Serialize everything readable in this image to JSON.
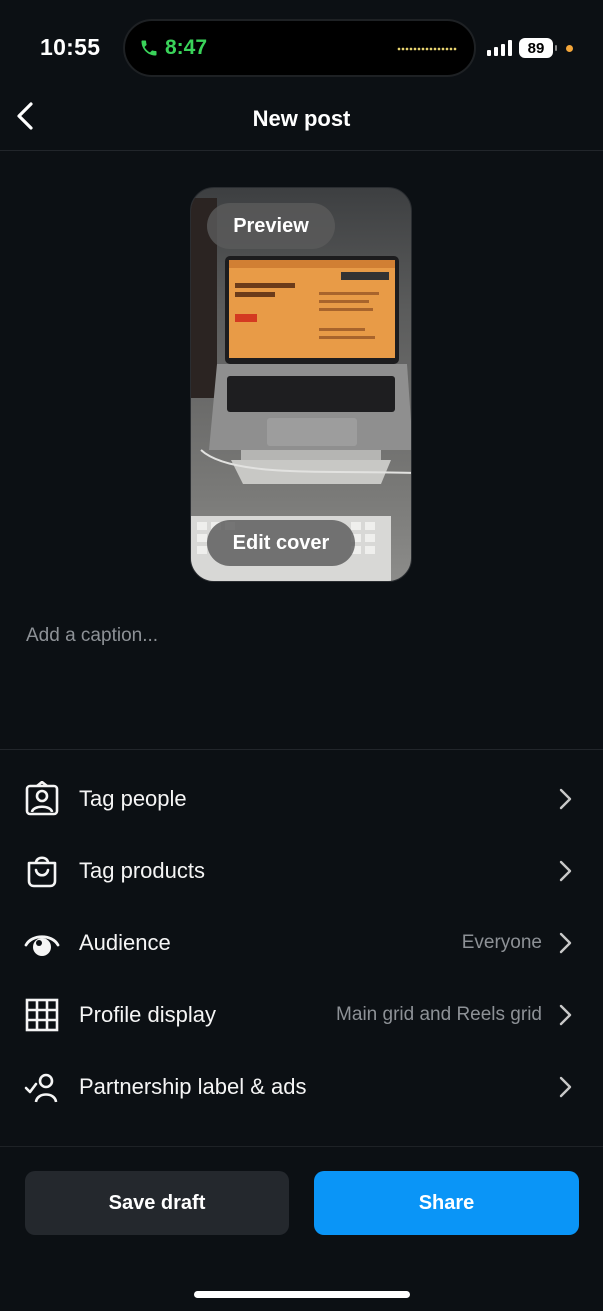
{
  "status_bar": {
    "time": "10:55",
    "call_time": "8:47",
    "battery": "89",
    "call_color": "#3ad35a",
    "privacy_dot_color": "#f4a63a"
  },
  "nav": {
    "back_icon": "chevron-left-icon",
    "title": "New post"
  },
  "preview": {
    "preview_label": "Preview",
    "edit_cover_label": "Edit cover"
  },
  "caption": {
    "placeholder": "Add a caption..."
  },
  "options": [
    {
      "icon": "tag-people-icon",
      "label": "Tag people",
      "value": ""
    },
    {
      "icon": "shopping-bag-icon",
      "label": "Tag products",
      "value": ""
    },
    {
      "icon": "eye-icon",
      "label": "Audience",
      "value": "Everyone"
    },
    {
      "icon": "grid-icon",
      "label": "Profile display",
      "value": "Main grid and Reels grid"
    },
    {
      "icon": "partnership-icon",
      "label": "Partnership label & ads",
      "value": ""
    }
  ],
  "footer": {
    "save_draft_label": "Save draft",
    "share_label": "Share",
    "share_color": "#0a95f7"
  },
  "colors": {
    "background": "#0c1014",
    "secondary_text": "#8d9196"
  }
}
